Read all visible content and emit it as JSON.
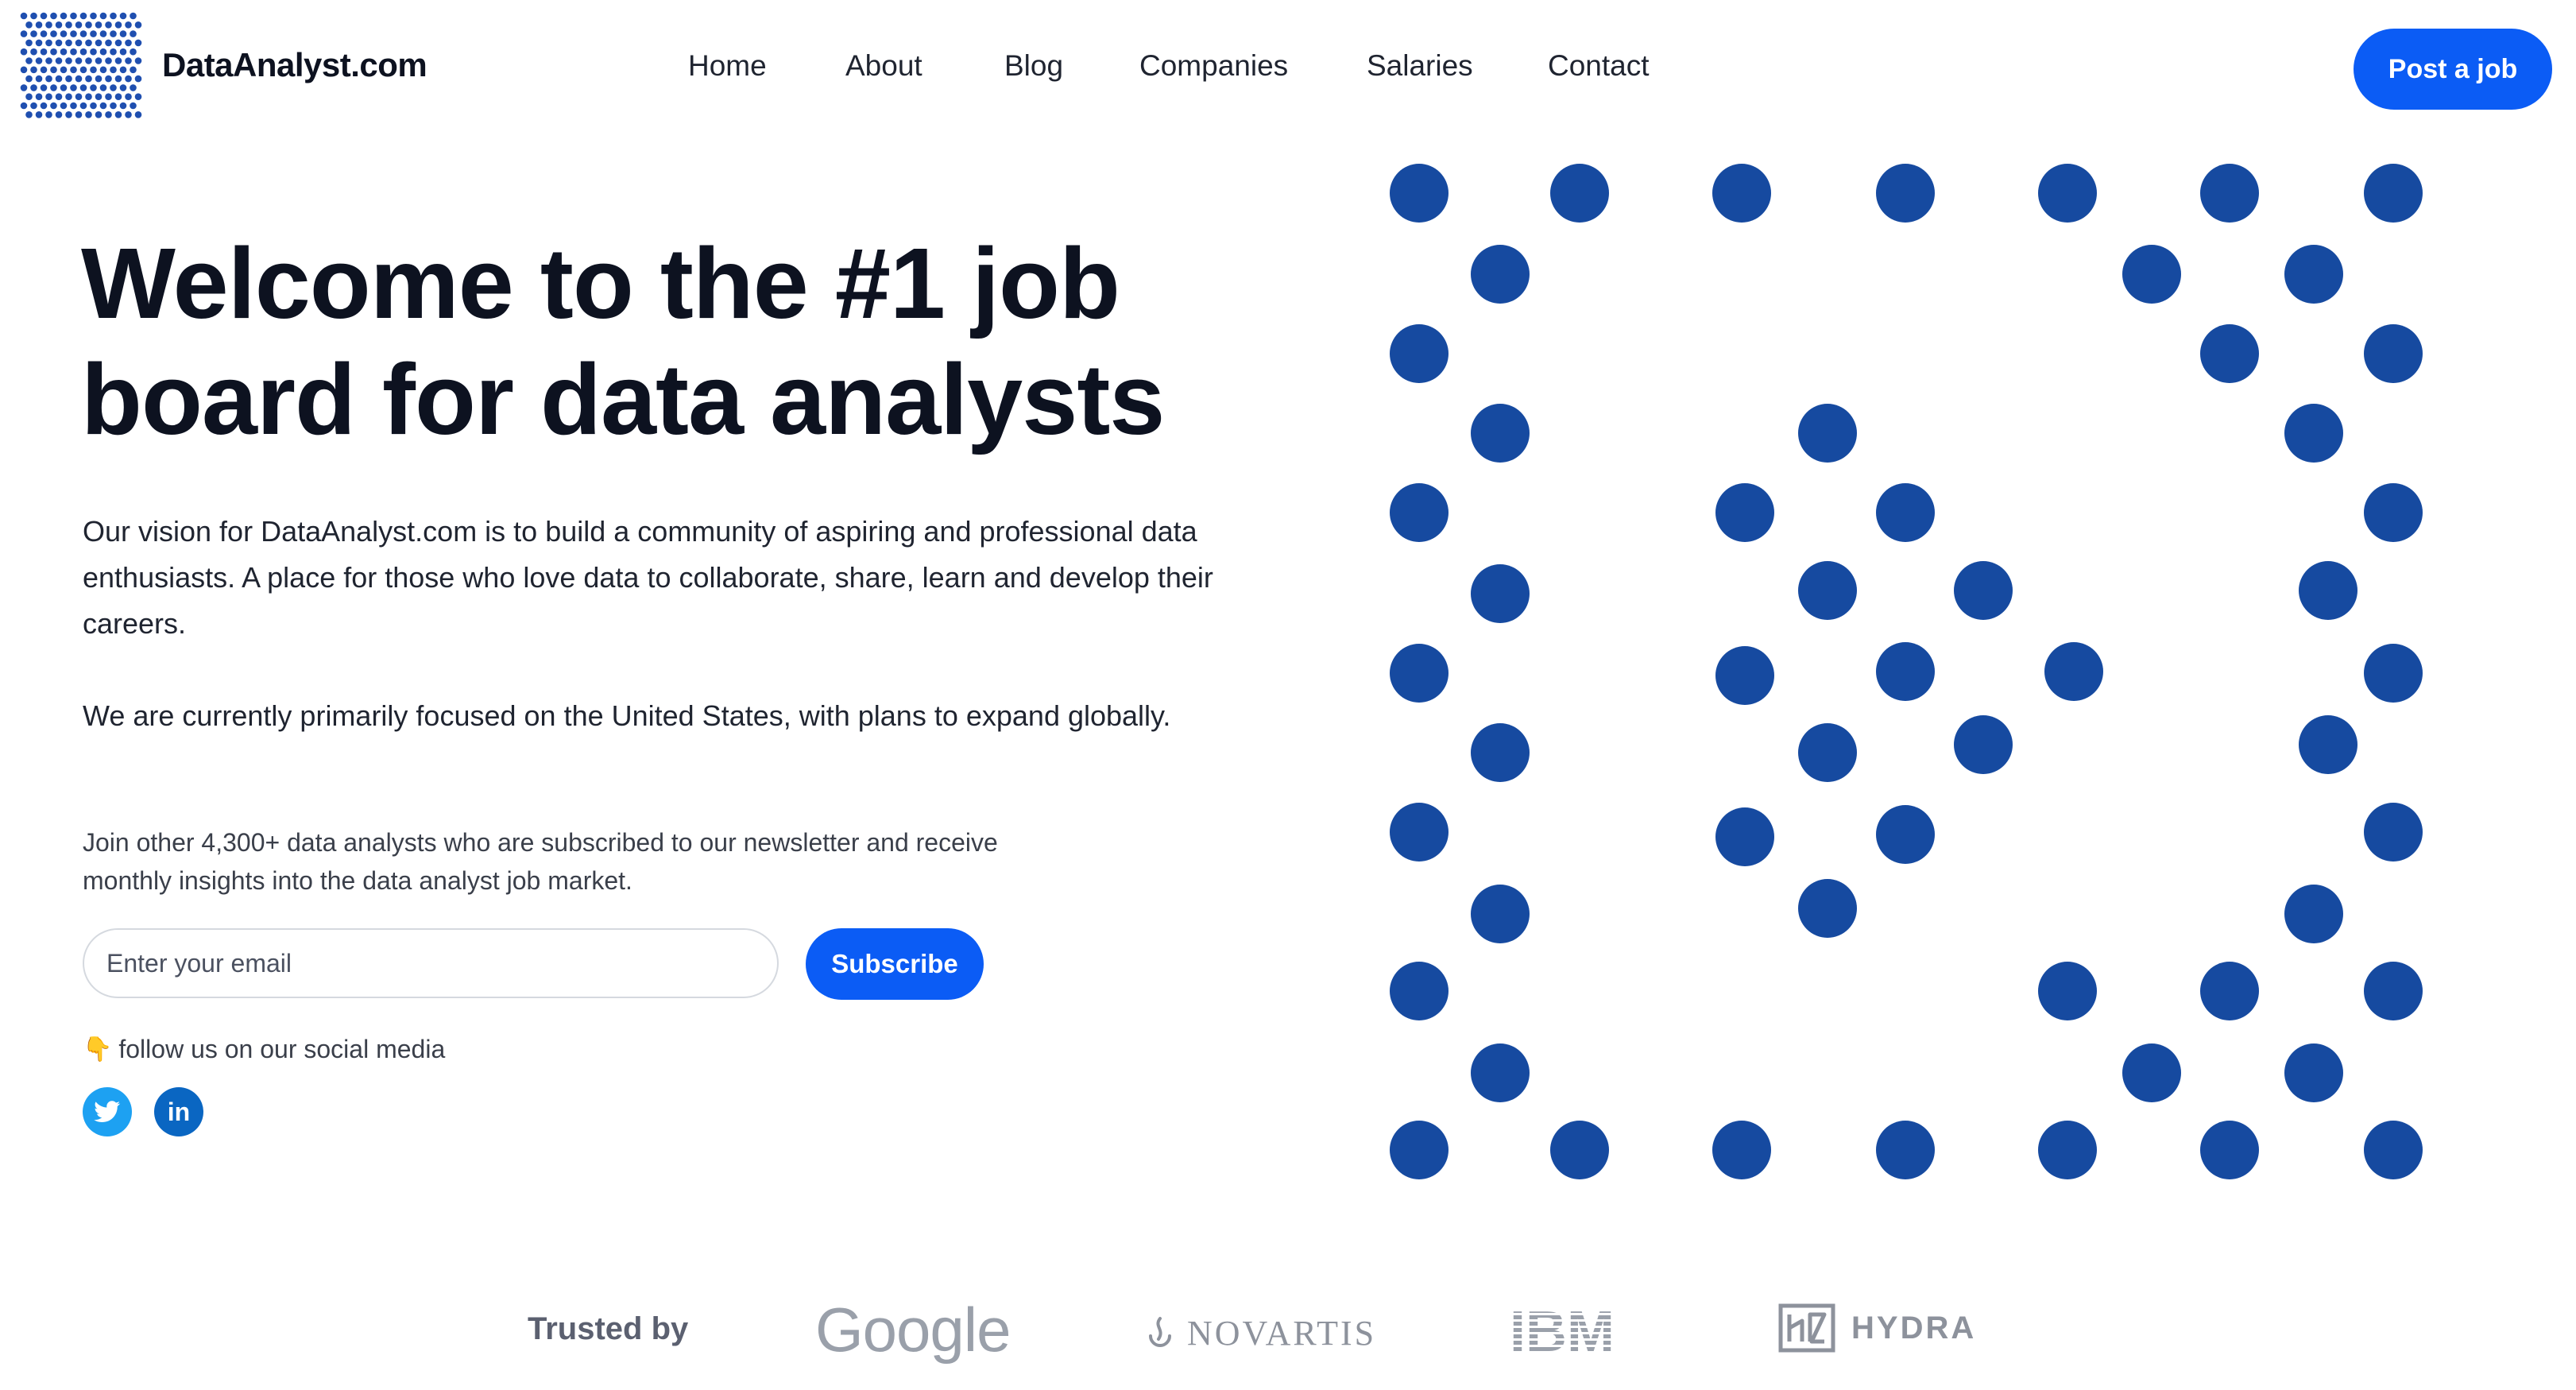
{
  "brand": {
    "name": "DataAnalyst.com",
    "logo_icon": "dotted-grid-logo-icon",
    "accent_color": "#0b5cf5",
    "dot_color": "#164aa0"
  },
  "nav": {
    "items": [
      "Home",
      "About",
      "Blog",
      "Companies",
      "Salaries",
      "Contact"
    ],
    "cta": "Post a job"
  },
  "hero": {
    "headline_line1": "Welcome to the #1 job",
    "headline_line2": "board for data analysts",
    "paragraph1": "Our vision for DataAnalyst.com is to build a community of aspiring and professional data enthusiasts. A place for those who love data to collaborate, share, learn and develop their careers.",
    "paragraph2": "We are currently primarily focused on the United States, with plans to expand globally."
  },
  "newsletter": {
    "text": "Join other 4,300+ data analysts who are subscribed to our newsletter and receive monthly insights into the data analyst job market.",
    "placeholder": "Enter your email",
    "button": "Subscribe"
  },
  "social": {
    "label": "follow us on our social media",
    "pointer_icon": "pointing-down-hand-icon",
    "links": [
      "twitter-icon",
      "linkedin-icon"
    ]
  },
  "trusted": {
    "label": "Trusted by",
    "logos": [
      "Google",
      "NOVARTIS",
      "IBM",
      "HYDRA"
    ]
  }
}
